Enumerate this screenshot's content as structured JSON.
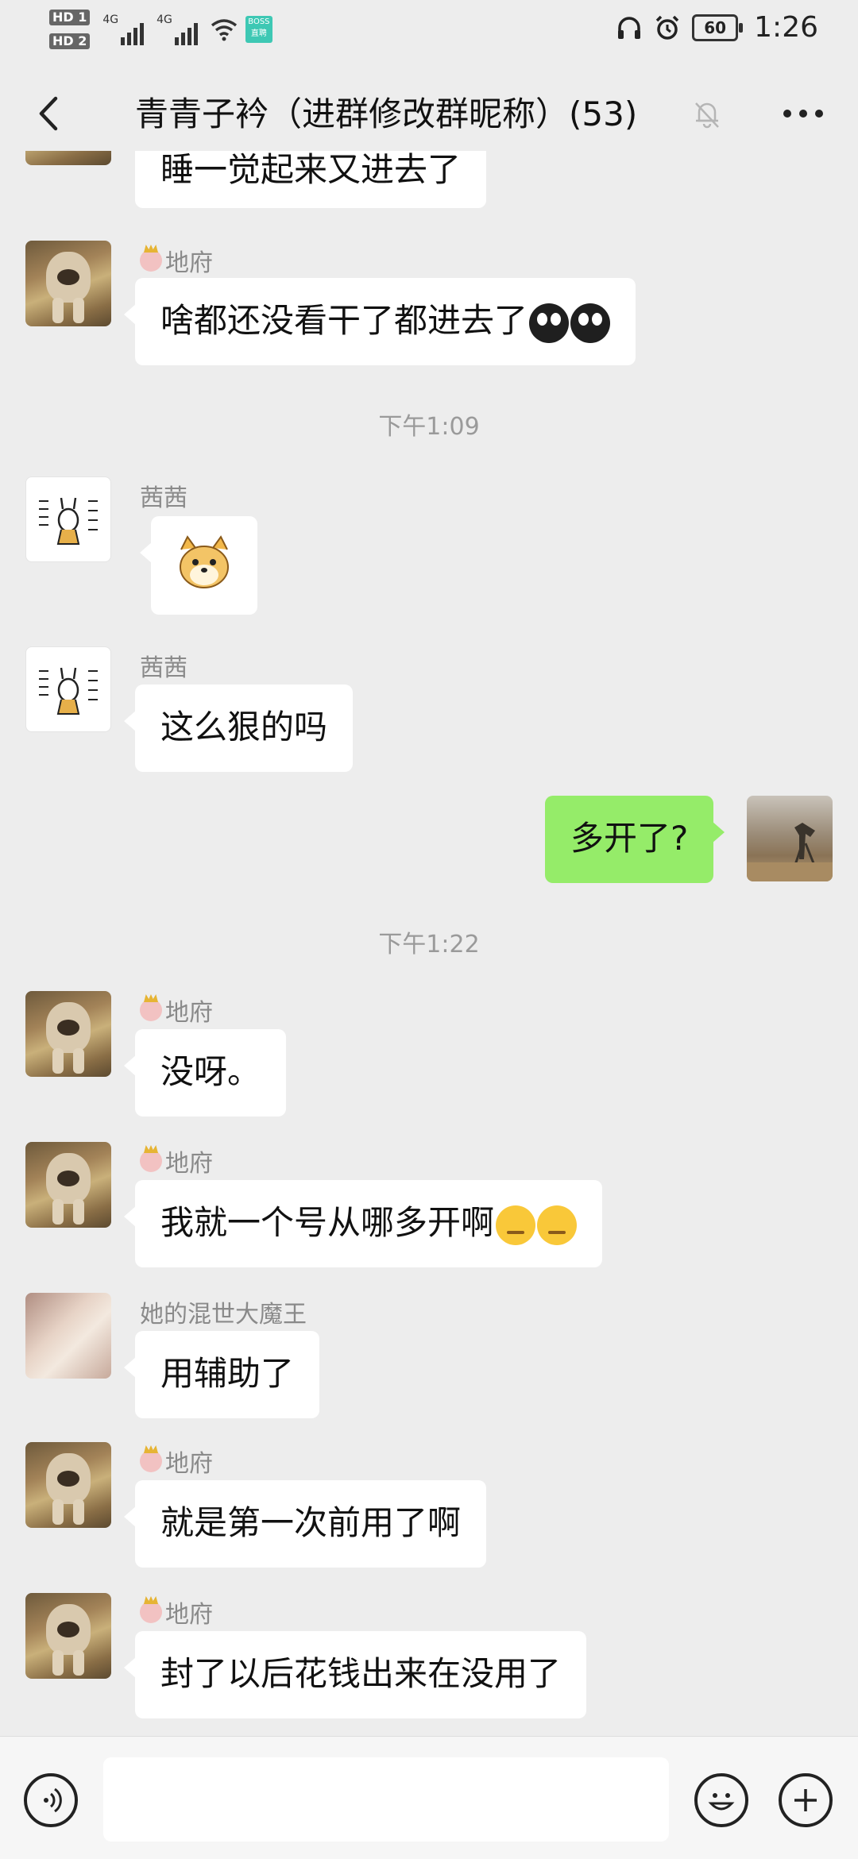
{
  "status_bar": {
    "hd1": "HD 1",
    "hd2": "HD 2",
    "net1": "4G",
    "net2": "4G",
    "boss_badge": "BOSS 直聘",
    "battery": "60",
    "time": "1:26"
  },
  "header": {
    "title": "青青子衿（进群修改群昵称）(53)"
  },
  "timestamps": [
    "下午1:09",
    "下午1:22"
  ],
  "messages": [
    {
      "sender": "",
      "text": "睡一觉起来又进去了"
    },
    {
      "sender": "地府",
      "text": "啥都还没看干了都进去了"
    },
    {
      "sender": "茜茜",
      "text": ""
    },
    {
      "sender": "茜茜",
      "text": "这么狠的吗"
    },
    {
      "sender": "",
      "text": "多开了?"
    },
    {
      "sender": "地府",
      "text": "没呀。"
    },
    {
      "sender": "地府",
      "text": "我就一个号从哪多开啊"
    },
    {
      "sender": "她的混世大魔王",
      "text": "用辅助了"
    },
    {
      "sender": "地府",
      "text": "就是第一次前用了啊"
    },
    {
      "sender": "地府",
      "text": "封了以后花钱出来在没用了"
    }
  ],
  "icons": {
    "back": "back-arrow-icon",
    "mute": "mute-bell-icon",
    "more": "more-icon",
    "voice": "voice-icon",
    "emoji": "emoji-icon",
    "add": "plus-icon"
  },
  "colors": {
    "background": "#ededed",
    "bubble_incoming": "#ffffff",
    "bubble_outgoing": "#95ec69",
    "timestamp": "#9a9a9a"
  }
}
